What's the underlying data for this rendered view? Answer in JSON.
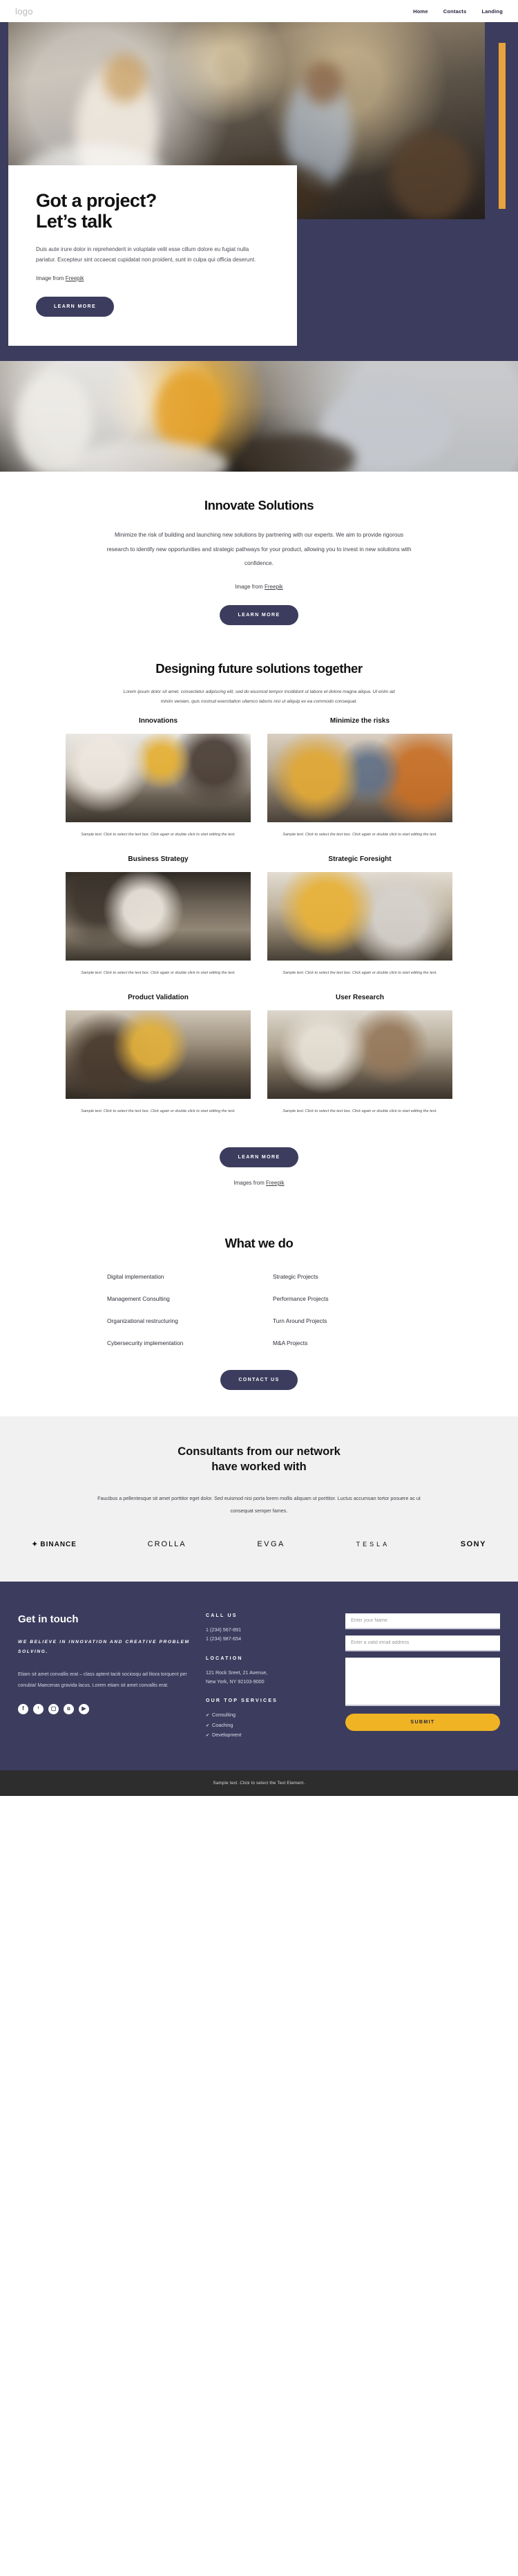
{
  "header": {
    "logo": "logo",
    "nav": [
      {
        "label": "Home"
      },
      {
        "label": "Contacts"
      },
      {
        "label": "Landing"
      }
    ]
  },
  "hero": {
    "title_line1": "Got a project?",
    "title_line2": "Let’s talk",
    "paragraph": "Duis aute irure dolor in reprehenderit in voluptate velit esse cillum dolore eu fugiat nulla pariatur. Excepteur sint occaecat cupidatat non proident, sunt in culpa qui officia deserunt.",
    "credit_prefix": "Image from ",
    "credit_link": "Freepik",
    "button": "LEARN MORE",
    "accent_color": "#e8a33d",
    "bg_color": "#3c3c5e"
  },
  "innovate": {
    "title": "Innovate Solutions",
    "paragraph": "Minimize the risk of building and launching new solutions by partnering with our experts. We aim to provide rigorous research to identify new opportunities and strategic pathways for your product, allowing you to invest in new solutions with confidence.",
    "credit_prefix": "Image from ",
    "credit_link": "Freepik",
    "button": "LEARN MORE"
  },
  "designing": {
    "title": "Designing future solutions together",
    "paragraph": "Lorem ipsum dolor sit amet, consectetur adipiscing elit, sed do eiusmod tempor incididunt ut labore et dolore magna aliqua. Ut enim ad minim veniam, quis nostrud exercitation ullamco laboris nisi ut aliquip ex ea commodo consequat.",
    "caption": "Sample text. Click to select the text box. Click again or double click to start editing the text.",
    "cards": [
      {
        "title": "Innovations"
      },
      {
        "title": "Minimize the risks"
      },
      {
        "title": "Business Strategy"
      },
      {
        "title": "Strategic Foresight"
      },
      {
        "title": "Product Validation"
      },
      {
        "title": "User Research"
      }
    ],
    "button": "LEARN MORE",
    "credit_prefix": "Images from ",
    "credit_link": "Freepik"
  },
  "what_we_do": {
    "title": "What we do",
    "items": [
      {
        "label": "Digital implementation"
      },
      {
        "label": "Strategic Projects"
      },
      {
        "label": "Management Consulting"
      },
      {
        "label": "Performance Projects"
      },
      {
        "label": "Organizational restructuring"
      },
      {
        "label": "Turn Around Projects"
      },
      {
        "label": "Cybersecurity implementation"
      },
      {
        "label": "M&A Projects"
      }
    ],
    "button": "CONTACT US"
  },
  "partners": {
    "title_line1": "Consultants from our network",
    "title_line2": "have worked with",
    "paragraph": "Faucibus a pellentesque sit amet porttitor eget dolor. Sed euismod nisi porta lorem mollis aliquam ut porttitor. Luctus accumsan tortor posuere ac ut consequat semper fames.",
    "logos": [
      {
        "name": "BINANCE"
      },
      {
        "name": "CROLLA"
      },
      {
        "name": "EVGA"
      },
      {
        "name": "TESLA"
      },
      {
        "name": "SONY"
      }
    ]
  },
  "footer": {
    "title": "Get in touch",
    "slogan": "WE BELIEVE IN INNOVATION AND CREATIVE PROBLEM SOLVING.",
    "text": "Etiam sit amet convallis erat – class aptent taciti sociosqu ad litora torquent per conubia! Maecenas gravida lacus. Lorem etiam sit amet convallis erat.",
    "socials": [
      {
        "name": "facebook",
        "glyph": "f"
      },
      {
        "name": "twitter",
        "glyph": "ᵗ"
      },
      {
        "name": "instagram",
        "glyph": "▢"
      },
      {
        "name": "vk",
        "glyph": "в"
      },
      {
        "name": "youtube",
        "glyph": "▶"
      }
    ],
    "call_us_heading": "CALL US",
    "phone1": "1 (234) 567-891",
    "phone2": "1 (234) 987-654",
    "location_heading": "LOCATION",
    "address1": "121 Rock Sreet, 21 Avenue,",
    "address2": "New York, NY 92103-9000",
    "services_heading": "OUR TOP SERVICES",
    "services": [
      {
        "label": "Consulting"
      },
      {
        "label": "Coaching"
      },
      {
        "label": "Development"
      }
    ],
    "form": {
      "name_placeholder": "Enter your Name",
      "email_placeholder": "Enter a valid email address",
      "message_placeholder": "",
      "submit": "SUBMIT",
      "submit_color": "#f0b323"
    }
  },
  "bottombar": {
    "text": "Sample text. Click to select the Text Element."
  }
}
